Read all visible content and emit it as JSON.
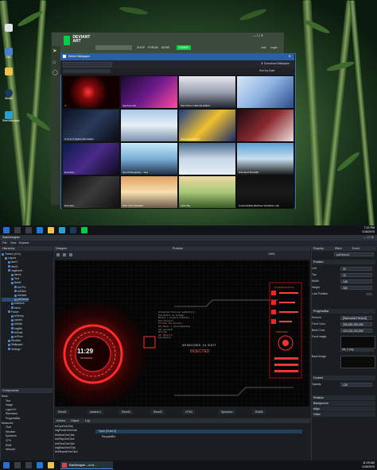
{
  "desktop": {
    "icons": [
      {
        "label": "",
        "color": "#e0e4ea"
      },
      {
        "label": "DOC",
        "color": "#4a7fc9"
      },
      {
        "label": "",
        "color": "#f0c24a"
      },
      {
        "label": "Steam",
        "color": "#1a3a5a"
      },
      {
        "label": "RainWallpape",
        "color": "#2aa0d0"
      }
    ]
  },
  "deviantart": {
    "logo_line1": "DEVIANT",
    "logo_line2": "ART",
    "nav": [
      "SHOP",
      "FORUM",
      "MORE"
    ],
    "submit_label": "SUBMIT",
    "right_links": [
      "Join",
      "Login"
    ]
  },
  "wallpaper_dialog": {
    "title": "Select Wallpaper",
    "download_label": "Download Wallpaper",
    "search_placeholder": "",
    "sort_label": "Sort by Date",
    "thumbs": [
      {
        "caption": "⟈",
        "bg": "radial-gradient(circle at 45% 50%,#ff3a3a 0,#8a0a0a 20%,#120000 55%)"
      },
      {
        "caption": "Aperture Car",
        "bg": "linear-gradient(135deg,#1a0a30,#6a1a8a,#ff4aa0)"
      },
      {
        "caption": "Star Citizen Ultimate Edition",
        "bg": "linear-gradient(180deg,#e8e8f0,#9aa0b0,#20242c)"
      },
      {
        "caption": "",
        "bg": "linear-gradient(135deg,#d8e8f8,#8ab0e0,#2a4a8a)"
      },
      {
        "caption": "A Lime in Space Recreation",
        "bg": "linear-gradient(135deg,#0a1020,#2a3a5a,#0a0a14)"
      },
      {
        "caption": "",
        "bg": "linear-gradient(180deg,#a8c8e8,#e8f0f8,#7890a8)"
      },
      {
        "caption": "VanGogh Inspired",
        "bg": "linear-gradient(135deg,#1a3a8a,#f0c030,#1a2a6a)"
      },
      {
        "caption": "",
        "bg": "linear-gradient(135deg,#1a0a10,#8a2a30,#f0e0e0)"
      },
      {
        "caption": "Evolution",
        "bg": "linear-gradient(135deg,#0a1a4a,#4a2a8a,#0a0a1a)"
      },
      {
        "caption": "Ilya Arkhangelsky – Sea",
        "bg": "linear-gradient(180deg,#c8e8f8,#7ab0d8,#20304a)"
      },
      {
        "caption": "Snowy",
        "bg": "linear-gradient(180deg,#4a6a8a,#c8d8e8,#e8eef4)"
      },
      {
        "caption": "Animated Snowfall",
        "bg": "linear-gradient(180deg,#5aa0d0,#c8e0f0,#1a1a1a)"
      },
      {
        "caption": "Reindeer",
        "bg": "linear-gradient(135deg,#0a0a0a,#3a3a3a,#101010)"
      },
      {
        "caption": "Sinh Clock Weather",
        "bg": "linear-gradient(180deg,#e0a060,#f8e0b0,#6a5a4a)"
      },
      {
        "caption": "Lake Sky",
        "bg": "linear-gradient(180deg,#f0d8a0,#a8c878,#3a5a2a)"
      },
      {
        "caption": "Customizable Rainbow Visualizer Lulu",
        "bg": "linear-gradient(180deg,#101010,#1a1a1a,#0a0a0a)"
      }
    ]
  },
  "taskbar_top": {
    "time": "7:22 PM",
    "date": "1/16/2019"
  },
  "app": {
    "title": "RainDesigner",
    "menu": [
      "File",
      "View",
      "Explorer"
    ],
    "hierarchy": {
      "header": "Hierarchy",
      "rows": [
        "Theme (4/10)",
        "Layout",
        "itemC",
        "itemD",
        "imgBreed",
        "itemA",
        "Text",
        "itemB",
        "txtCPU",
        "txtRAM",
        "txtUsed",
        "picDevice",
        "txtAbove",
        "Itemx",
        "Frame",
        "txtTemp",
        "picMet",
        "txtDisk",
        "imgBtn",
        "txtDate",
        "txtTime",
        "Weather",
        "Wallpaper",
        "Settings"
      ]
    },
    "components": {
      "header": "Components",
      "rows": [
        "Basic",
        "Text",
        "Image",
        "Layer/XX",
        "Rainmeter",
        "ProgressBar",
        "Measures",
        "Time",
        "Weather",
        "Spectrum",
        "CPU",
        "RAM",
        "Network"
      ]
    },
    "designer": {
      "header": "Designer",
      "preview": "Preview",
      "zoom": "100%"
    },
    "canvas": {
      "clock": "11:29",
      "clock_sub": "01/16/2019",
      "windows_label": "WINDOWS 10 EDIT",
      "injected": "INJECTED",
      "right_title": "SYSTEM STATUS",
      "weather": "WEATHER",
      "code_lines": [
        "Protected Function SetButton()",
        "  Dim Button As Integer",
        "  Button = Convert.ToInt32(...)",
        "End Function",
        "Private Sub OnLoad()",
        "  Set Meter = [PreviewStats]",
        "  Set.Value(0)",
        "End Sub",
        "Get Meter(1)",
        "Dim Radius"
      ]
    },
    "status_tabs": [
      "Sheet1",
      "weather1",
      "Sheet3",
      "Sheet2",
      "CPU3",
      "Spectrum",
      "RAM3"
    ],
    "properties": {
      "tabs": [
        "Property",
        "Effect",
        "Event"
      ],
      "name_value": "picDevice1",
      "sections": {
        "position": "Position",
        "progressbar": "ProgressBar",
        "content": "Content",
        "rotation": "Rotation",
        "background": "Background",
        "align": "Align",
        "other": "Other"
      },
      "left": "20",
      "top": "10",
      "width": "148",
      "height": "160",
      "lock_position": "Lock Position",
      "percent_label": "Percent",
      "percent_value": "[Rainmeter.Percent]",
      "front_color_label": "Front Color",
      "front_color": "255,255,255,255",
      "back_color_label": "Back Color",
      "back_color": "120,120,120,255",
      "front_image_label": "Front Image",
      "back_image_label": "Back Image",
      "image_value": "bar_2.png",
      "opacity_label": "Opacity",
      "opacity_value": "128"
    },
    "bottom": {
      "tabs": [
        "Actions",
        "Output",
        "Log"
      ],
      "list": [
        "txtCpuOneClick",
        "imgPowerOneClick",
        "btnNextOneClick",
        "btnPlayOneClick",
        "btnPrevOneClick",
        "imgBaseOneClick",
        "btnRepeatOneClick"
      ],
      "action": "Open [Drive:3]",
      "action_sub": "RecycleBin"
    }
  },
  "taskbar_bottom": {
    "search_placeholder": "",
    "app_label": "RainDesigner – ui.rd...",
    "time": "11:29 AM",
    "date": "1/16/2019"
  }
}
